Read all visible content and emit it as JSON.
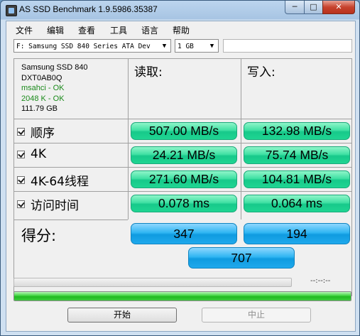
{
  "window": {
    "title": "AS SSD Benchmark 1.9.5986.35387",
    "minimize_label": "─",
    "maximize_label": "□",
    "close_label": "✕"
  },
  "menu": [
    "文件",
    "编辑",
    "查看",
    "工具",
    "语言",
    "帮助"
  ],
  "drive_select": {
    "value": "F: Samsung SSD 840 Series ATA Dev",
    "arrow": "▼"
  },
  "size_select": {
    "value": "1 GB",
    "arrow": "▼"
  },
  "drive_info": {
    "model": "Samsung SSD 840",
    "firmware": "DXT0AB0Q",
    "driver": "msahci - OK",
    "alignment": "2048 K - OK",
    "capacity": "111.79 GB"
  },
  "columns": {
    "read": "读取:",
    "write": "写入:"
  },
  "tests": [
    {
      "label": "顺序",
      "read": "507.00 MB/s",
      "write": "132.98 MB/s"
    },
    {
      "label": "4K",
      "read": "24.21 MB/s",
      "write": "75.74 MB/s"
    },
    {
      "label": "4K-64线程",
      "read": "271.60 MB/s",
      "write": "104.81 MB/s"
    },
    {
      "label": "访问时间",
      "read": "0.078 ms",
      "write": "0.064 ms"
    }
  ],
  "score": {
    "label": "得分:",
    "read": "347",
    "write": "194",
    "total": "707"
  },
  "progress": {
    "timer": "--:--:--",
    "test_progress": 0,
    "total_progress": 1.0
  },
  "buttons": {
    "start": "开始",
    "stop": "中止"
  },
  "colors": {
    "result_green": "#1fd592",
    "score_blue": "#1fa9ec",
    "progress_green": "#21b921"
  }
}
